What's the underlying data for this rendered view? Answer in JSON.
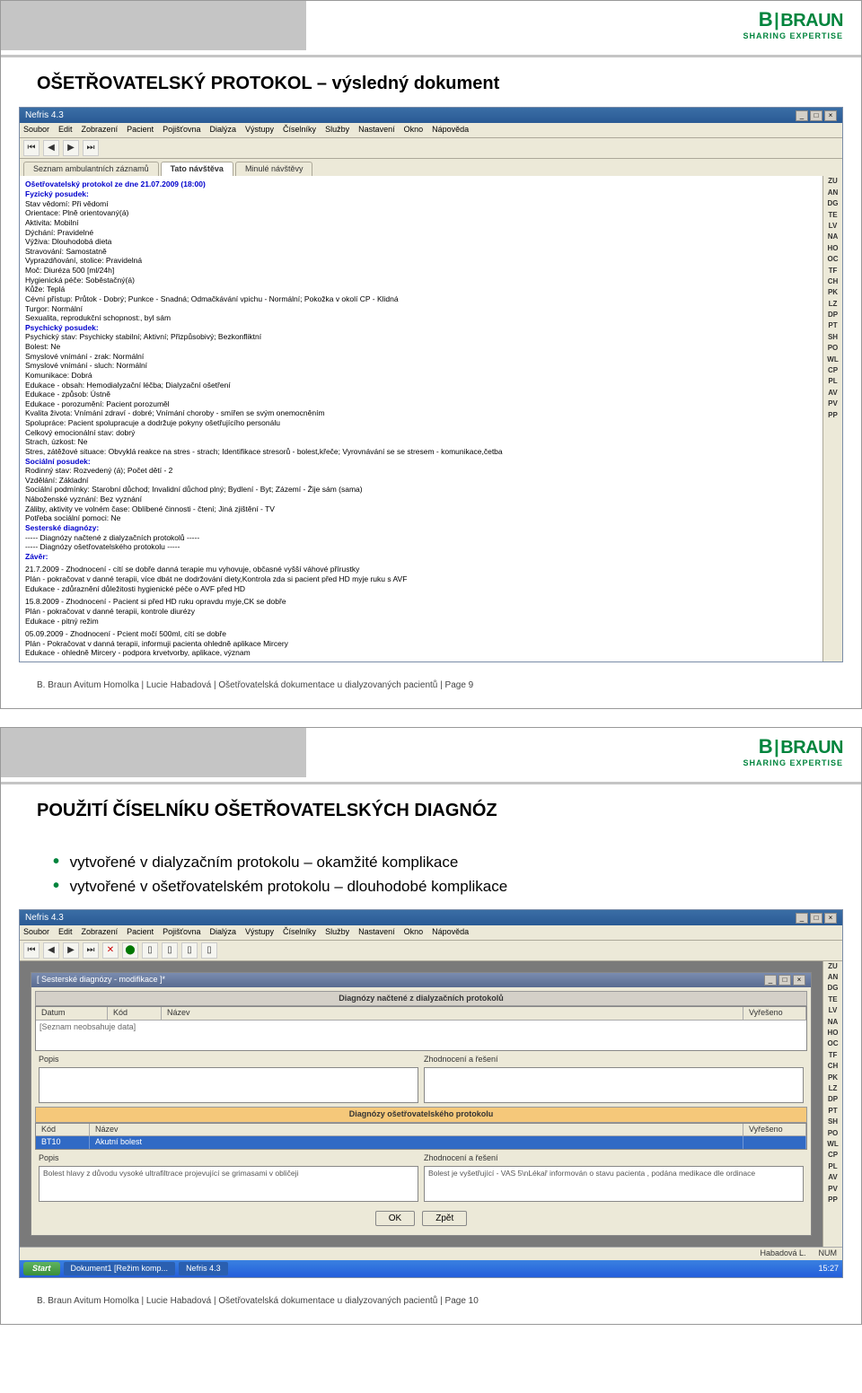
{
  "logo": {
    "brand": "B|BRAUN",
    "tagline": "SHARING EXPERTISE"
  },
  "slide1": {
    "title": "OŠETŘOVATELSKÝ PROTOKOL – výsledný dokument",
    "footer": "B. Braun Avitum Homolka | Lucie Habadová | Ošetřovatelská dokumentace u dialyzovaných pacientů | Page  9",
    "app": {
      "title": "Nefris 4.3",
      "menu": [
        "Soubor",
        "Edit",
        "Zobrazení",
        "Pacient",
        "Pojišťovna",
        "Dialýza",
        "Výstupy",
        "Číselníky",
        "Služby",
        "Nastavení",
        "Okno",
        "Nápověda"
      ],
      "tabs": [
        "Seznam ambulantních záznamů",
        "Tato návštěva",
        "Minulé návštěvy"
      ],
      "sidebar": [
        "ZU",
        "AN",
        "DG",
        "TE",
        "LV",
        "NA",
        "HO",
        "OC",
        "TF",
        "CH",
        "PK",
        "LZ",
        "DP",
        "PT",
        "SH",
        "PO",
        "WL",
        "CP",
        "PL",
        "AV",
        "PV",
        "PP"
      ],
      "content": {
        "header": "Ošetřovatelský protokol ze dne 21.07.2009 (18:00)",
        "s1": "Fyzický posudek:",
        "l1a": "Stav vědomí: Při vědomí",
        "l1b": "Orientace: Plně orientovaný(á)",
        "l1c": "Aktivita: Mobilní",
        "l1d": "Dýchání: Pravidelné",
        "l1e": "Výživa: Dlouhodobá dieta",
        "l1f": "Stravování: Samostatně",
        "l1g": "Vyprazdňování, stolice: Pravidelná",
        "l1h": "Moč: Diuréza 500 [ml/24h]",
        "l1i": "Hygienická péče: Soběstačný(á)",
        "l1j": "Kůže: Teplá",
        "l1k": "Cévní přístup: Průtok - Dobrý; Punkce - Snadná; Odmačkávání vpichu - Normální; Pokožka v okolí CP - Klidná",
        "l1l": "Turgor: Normální",
        "l1m": "Sexualita, reprodukční schopnost:, byl sám",
        "s2": "Psychický posudek:",
        "l2a": "Psychický stav: Psychicky stabilní; Aktivní; Přizpůsobivý; Bezkonfliktní",
        "l2b": "Bolest: Ne",
        "l2c": "Smyslové vnímání - zrak: Normální",
        "l2d": "Smyslové vnímání - sluch: Normální",
        "l2e": "Komunikace: Dobrá",
        "l2f": "Edukace - obsah: Hemodialyzační léčba; Dialyzační ošetření",
        "l2g": "Edukace - způsob: Ústně",
        "l2h": "Edukace - porozumění: Pacient porozuměl",
        "l2i": "Kvalita života: Vnímání zdraví - dobré; Vnímání choroby - smířen se svým onemocněním",
        "l2j": "Spolupráce: Pacient spolupracuje a dodržuje pokyny ošetřujícího personálu",
        "l2k": "Celkový emocionální stav: dobrý",
        "l2l": "Strach, úzkost: Ne",
        "l2m": "Stres, zátěžové situace: Obvyklá reakce na stres - strach; Identifikace stresorů - bolest,křeče; Vyrovnávání se se stresem - komunikace,četba",
        "s3": "Sociální posudek:",
        "l3a": "Rodinný stav: Rozvedený (á); Počet dětí - 2",
        "l3b": "Vzdělání: Základní",
        "l3c": "Sociální podmínky: Starobní důchod; Invalidní důchod plný; Bydlení - Byt; Zázemí - Žije sám (sama)",
        "l3d": "Náboženské vyznání: Bez vyznání",
        "l3e": "Záliby, aktivity ve volném čase: Oblíbené činnosti - čtení; Jiná zjištění - TV",
        "l3f": "Potřeba sociální pomoci: Ne",
        "s4": "Sesterské diagnózy:",
        "l4a": "----- Diagnózy načtené z dialyzačních protokolů -----",
        "l4b": "----- Diagnózy ošetřovatelského protokolu -----",
        "s5": "Závěr:",
        "l5a": "21.7.2009 - Zhodnocení - cítí se dobře danná terapie mu vyhovuje, občasné vyšší váhové přírustky",
        "l5b": "                Plán - pokračovat v danné terapii, více dbát ne dodržování diety,Kontrola zda si pacient před HD myje ruku s AVF",
        "l5c": "                Edukace - zdůraznění důležitosti hygienické péče o AVF před HD",
        "l5d": "15.8.2009 - Zhodnocení - Pacient si před HD ruku opravdu myje,CK se dobře",
        "l5e": "                Plán - pokračovat v danné terapii, kontrole diurézy",
        "l5f": "                Edukace - pitný režim",
        "l5g": "05.09.2009 - Zhodnocení - Pcient močí 500ml, cítí se dobře",
        "l5h": "                Plán - Pokračovat v danná terapii, informuji pacienta ohledně aplikace Mircery",
        "l5i": "                Edukace - ohledně Mircery - podpora krvetvorby, aplikace, význam"
      }
    }
  },
  "slide2": {
    "title": "POUŽITÍ ČÍSELNÍKU OŠETŘOVATELSKÝCH DIAGNÓZ",
    "bullet1": "vytvořené v dialyzačním protokolu – okamžité komplikace",
    "bullet2": "vytvořené v ošetřovatelském protokolu – dlouhodobé komplikace",
    "footer": "B. Braun Avitum Homolka | Lucie Habadová | Ošetřovatelská dokumentace u dialyzovaných pacientů | Page  10",
    "app": {
      "title": "Nefris 4.3",
      "menu": [
        "Soubor",
        "Edit",
        "Zobrazení",
        "Pacient",
        "Pojišťovna",
        "Dialýza",
        "Výstupy",
        "Číselníky",
        "Služby",
        "Nastavení",
        "Okno",
        "Nápověda"
      ],
      "inner_title": "[ Sesterské diagnózy - modifikace ]*",
      "sec1": "Diagnózy načtené z dialyzačních protokolů",
      "cols": {
        "c1": "Datum",
        "c2": "Kód",
        "c3": "Název",
        "c4": "Vyřešeno"
      },
      "empty": "[Seznam neobsahuje data]",
      "field_popis": "Popis",
      "field_zhod": "Zhodnocení a řešení",
      "sec2": "Diagnózy ošetřovatelského protokolu",
      "cols2": {
        "c1": "Kód",
        "c2": "Název",
        "c3": "Vyřešeno"
      },
      "row": {
        "kod": "BT10",
        "nazev": "Akutní bolest"
      },
      "popis_text": "Bolest hlavy z důvodu vysoké ultrafiltrace projevující se grimasami v obličeji",
      "zhod_text": "Bolest je vyšetřující - VAS 5\\nLékař informován o stavu pacienta , podána medikace dle ordinace",
      "btn_ok": "OK",
      "btn_zpet": "Zpět",
      "status_user": "Habadová L.",
      "status_num": "NUM",
      "taskbar": {
        "start": "Start",
        "t1": "Dokument1 [Režim komp...",
        "t2": "Nefris 4.3",
        "time": "15:27"
      },
      "sidebar": [
        "ZU",
        "AN",
        "DG",
        "TE",
        "LV",
        "NA",
        "HO",
        "OC",
        "TF",
        "CH",
        "PK",
        "LZ",
        "DP",
        "PT",
        "SH",
        "PO",
        "WL",
        "CP",
        "PL",
        "AV",
        "PV",
        "PP"
      ]
    }
  }
}
